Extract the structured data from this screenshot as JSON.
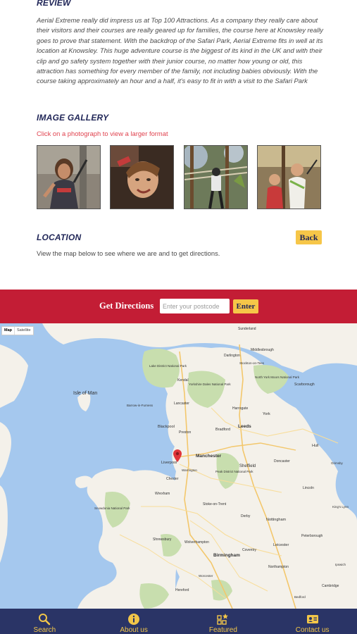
{
  "review": {
    "title": "REVIEW",
    "text": "Aerial Extreme really did impress us at Top 100 Attractions. As a company they really care about their visitors and their courses are really geared up for families, the course here at Knowsley really goes to prove that statement. With the backdrop of the Safari Park, Aerial Extreme fits in well at its location at Knowsley. This huge adventure course is the biggest of its kind in the UK and with their clip and go safety system together with their junior course, no matter how young or old, this attraction has something for every member of the family, not including babies obviously. With the course taking approximately an hour and a half, it's easy to fit in with a visit to the Safari Park"
  },
  "gallery": {
    "title": "IMAGE GALLERY",
    "hint": "Click on a photograph to view a larger format"
  },
  "location": {
    "title": "LOCATION",
    "text": "View the map below to see where we are and to get directions.",
    "back_label": "Back"
  },
  "directions": {
    "label": "Get Directions",
    "placeholder": "Enter your postcode",
    "enter_label": "Enter"
  },
  "map": {
    "toggle_map": "Map",
    "toggle_satellite": "Satellite",
    "places": {
      "isle_of_man": "Isle of Man",
      "liverpool": "Liverpool",
      "manchester": "Manchester",
      "leeds": "Leeds",
      "bradford": "Bradford",
      "sheffield": "Sheffield",
      "york": "York",
      "blackpool": "Blackpool",
      "preston": "Preston",
      "stoke": "Stoke-on-Trent",
      "birmingham": "Birmingham",
      "nottingham": "Nottingham",
      "leicester": "Leicester",
      "middlesbrough": "Middlesbrough",
      "sunderland": "Sunderland",
      "hull": "Hull",
      "lincoln": "Lincoln",
      "peterborough": "Peterborough",
      "wolverhampton": "Wolverhampton",
      "coventry": "Coventry",
      "northampton": "Northampton",
      "cambridge": "Cambridge",
      "lake_district": "Lake District National Park",
      "yorkshire_dales": "Yorkshire Dales National Park",
      "north_york_moors": "North York Moors National Park",
      "peak_district": "Peak District National Park",
      "snowdonia": "Snowdonia National Park",
      "hereford": "Hereford",
      "scarborough": "Scarborough",
      "doncaster": "Doncaster",
      "derby": "Derby",
      "shrewsbury": "Shrewsbury",
      "chester": "Chester",
      "wrexham": "Wrexham",
      "harrogate": "Harrogate",
      "lancaster": "Lancaster",
      "kendal": "Kendal",
      "darlington": "Darlington",
      "stockton": "Stockton-on-Tees",
      "grimsby": "Grimsby",
      "kings_lynn": "King's Lynn",
      "ipswich": "Ipswich",
      "bedford": "Bedford",
      "worcester": "Worcester",
      "warrington": "Warrington",
      "barrow": "Barrow-in-Furness"
    }
  },
  "nav": {
    "items": [
      {
        "label": "Search",
        "icon": "search-icon"
      },
      {
        "label": "About us",
        "icon": "info-icon"
      },
      {
        "label": "Featured",
        "icon": "featured-icon"
      },
      {
        "label": "Contact us",
        "icon": "contact-card-icon"
      }
    ]
  },
  "colors": {
    "heading": "#1f2557",
    "hint": "#e0434f",
    "accent": "#f6c648",
    "directions_bar": "#c31d35",
    "navbar": "#2a3466",
    "nav_label": "#f2c649"
  }
}
